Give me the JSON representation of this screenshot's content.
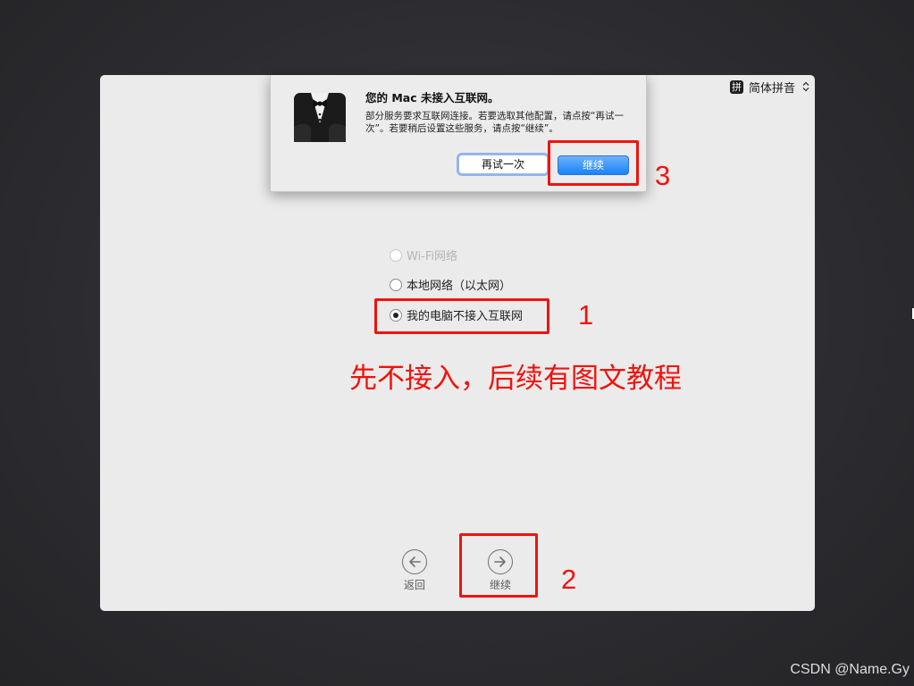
{
  "input_method": {
    "badge": "拼",
    "label": "简体拼音"
  },
  "dialog": {
    "title": "您的 Mac 未接入互联网。",
    "body": "部分服务要求互联网连接。若要选取其他配置，请点按“再试一次”。若要稍后设置这些服务，请点按“继续”。",
    "retry_label": "再试一次",
    "continue_label": "继续"
  },
  "network_options": [
    {
      "label": "Wi-Fi网络",
      "disabled": true,
      "selected": false
    },
    {
      "label": "本地网络（以太网）",
      "disabled": false,
      "selected": false
    },
    {
      "label": "我的电脑不接入互联网",
      "disabled": false,
      "selected": true
    }
  ],
  "nav": {
    "back_label": "返回",
    "continue_label": "继续"
  },
  "annotations": {
    "num1": "1",
    "num2": "2",
    "num3": "3",
    "note": "先不接入，后续有图文教程",
    "color": "#f2120c"
  },
  "watermark": "CSDN @Name.Gy"
}
